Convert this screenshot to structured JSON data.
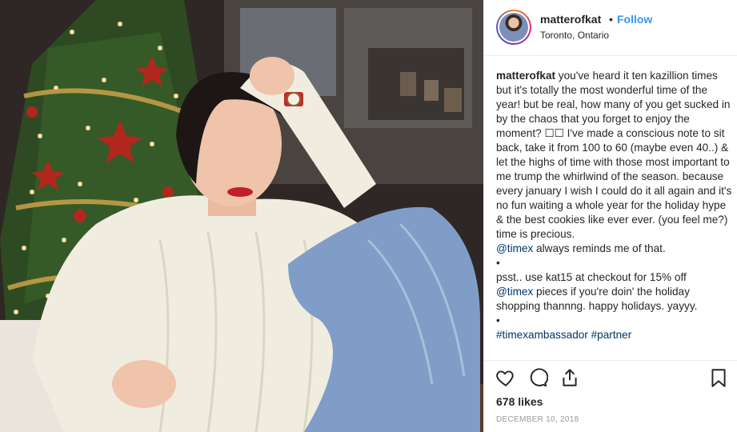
{
  "post": {
    "username": "matterofkat",
    "separator": "•",
    "follow_label": "Follow",
    "location": "Toronto, Ontario",
    "caption": {
      "username": "matterofkat",
      "body": " you've heard it ten kazillion times but it's totally the most wonderful time of the year! but be real, how many of you get sucked in by the chaos that you forget to enjoy the moment? ☐☐ I've made a conscious note to sit back, take it from 100 to 60 (maybe even 40..) & let the highs of time with those most important to me trump the whirlwind of the season. because every january I wish I could do it all again and it's no fun waiting a whole year for the holiday hype & the best cookies like ever ever. (you feel me?) time is precious.",
      "mention1": "@timex",
      "line1_end": " always reminds me of that.",
      "bullet1": "•",
      "line2": "psst.. use kat15 at checkout for 15% off",
      "mention2": "@timex",
      "line2_end": " pieces if you're doin' the holiday shopping thannng. happy holidays. yayyy.",
      "bullet2": "•",
      "hashtag1": "#timexambassador",
      "hashtag2": "#partner"
    },
    "likes": "678 likes",
    "date": "DECEMBER 10, 2018"
  },
  "colors": {
    "link": "#3897f0",
    "mention": "#003569",
    "text": "#262626",
    "muted": "#999999"
  },
  "icons": [
    "heart-icon",
    "comment-icon",
    "share-icon",
    "bookmark-icon"
  ]
}
